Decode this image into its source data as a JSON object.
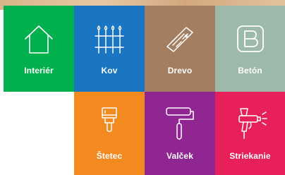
{
  "tiles": {
    "interier": {
      "label": "Interiér",
      "icon": "house-icon",
      "color": "#00b04d"
    },
    "kov": {
      "label": "Kov",
      "icon": "fence-icon",
      "color": "#1a76c2"
    },
    "drevo": {
      "label": "Drevo",
      "icon": "wood-plank-icon",
      "color": "#a37e60"
    },
    "beton": {
      "label": "Betón",
      "icon": "concrete-block-icon",
      "color": "#9db9aa"
    },
    "stetec": {
      "label": "Štetec",
      "icon": "paint-brush-icon",
      "color": "#f28a20"
    },
    "valcek": {
      "label": "Valček",
      "icon": "paint-roller-icon",
      "color": "#8f2692"
    },
    "striekanie": {
      "label": "Striekanie",
      "icon": "spray-gun-icon",
      "color": "#e8205a"
    }
  }
}
